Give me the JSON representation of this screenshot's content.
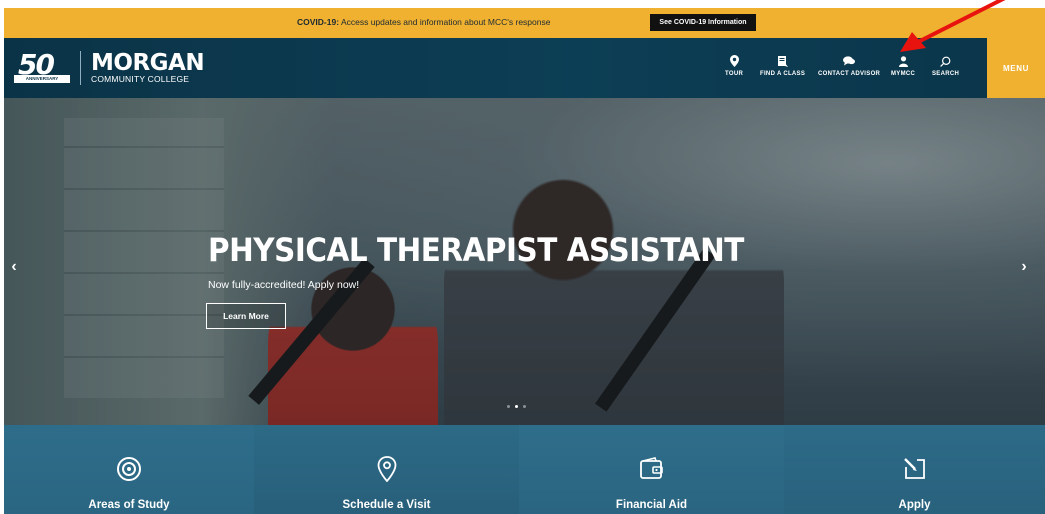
{
  "covid": {
    "label": "COVID-19:",
    "text": " Access updates and information about MCC's response",
    "button": "See COVID-19 Information"
  },
  "logo": {
    "anniversary_number": "50",
    "anniversary_ribbon": "ANNIVERSARY",
    "name": "MORGAN",
    "subtitle": "COMMUNITY COLLEGE"
  },
  "nav": {
    "items": [
      {
        "label": "TOUR",
        "icon": "location-pin-icon"
      },
      {
        "label": "FIND A CLASS",
        "icon": "book-icon"
      },
      {
        "label": "CONTACT ADVISOR",
        "icon": "chat-icon"
      },
      {
        "label": "MYMCC",
        "icon": "user-icon"
      },
      {
        "label": "SEARCH",
        "icon": "search-icon"
      }
    ],
    "menu": "MENU"
  },
  "hero": {
    "title": "PHYSICAL THERAPIST ASSISTANT",
    "subtitle": "Now fully-accredited! Apply now!",
    "button": "Learn More",
    "prev": "‹",
    "next": "›",
    "slide_count": 3,
    "active_slide": 2
  },
  "quick_links": [
    {
      "label": "Areas of Study",
      "icon": "target-icon"
    },
    {
      "label": "Schedule a Visit",
      "icon": "location-pin-icon"
    },
    {
      "label": "Financial Aid",
      "icon": "wallet-icon"
    },
    {
      "label": "Apply",
      "icon": "edit-icon"
    }
  ],
  "colors": {
    "brand_gold": "#efb12f",
    "header_navy": "#0b3347",
    "quick_blue": "#2c6a86",
    "annotation_red": "#e8130f"
  }
}
